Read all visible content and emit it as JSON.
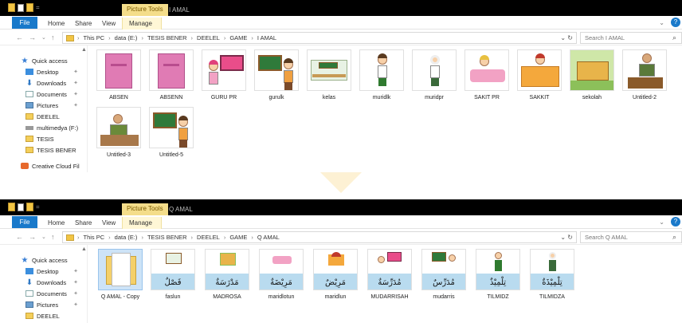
{
  "windows": [
    {
      "picture_tools": "Picture Tools",
      "title": "I AMAL",
      "tabs": [
        "File",
        "Home",
        "Share",
        "View",
        "Manage"
      ],
      "path": [
        "This PC",
        "data (E:)",
        "TESIS BENER",
        "DEELEL",
        "GAME",
        "I AMAL"
      ],
      "search_placeholder": "Search I AMAL",
      "nav_items": [
        {
          "label": "Quick access",
          "icon": "star-icon"
        },
        {
          "label": "Desktop",
          "icon": "desktop-icon",
          "pin": true
        },
        {
          "label": "Downloads",
          "icon": "download-icon",
          "pin": true
        },
        {
          "label": "Documents",
          "icon": "documents-icon",
          "pin": true
        },
        {
          "label": "Pictures",
          "icon": "pictures-icon",
          "pin": true
        },
        {
          "label": "DEELEL",
          "icon": "folder-icon"
        },
        {
          "label": "multimedya (F:)",
          "icon": "drive-icon"
        },
        {
          "label": "TESIS",
          "icon": "folder-icon"
        },
        {
          "label": "TESIS BENER",
          "icon": "folder-icon"
        },
        {
          "label": "Creative Cloud Fil",
          "icon": "creative-cloud-icon"
        }
      ],
      "files": [
        "ABSEN",
        "ABSENN",
        "GURU PR",
        "gurulk",
        "kelas",
        "muridlk",
        "muridpr",
        "SAKIT PR",
        "SAKKIT",
        "sekolah",
        "Untitled-2",
        "Untitled-3",
        "Untitled-5"
      ]
    },
    {
      "picture_tools": "Picture Tools",
      "title": "Q AMAL",
      "tabs": [
        "File",
        "Home",
        "Share",
        "View",
        "Manage"
      ],
      "path": [
        "This PC",
        "data (E:)",
        "TESIS BENER",
        "DEELEL",
        "GAME",
        "Q AMAL"
      ],
      "search_placeholder": "Search Q AMAL",
      "nav_items": [
        {
          "label": "Quick access",
          "icon": "star-icon"
        },
        {
          "label": "Desktop",
          "icon": "desktop-icon",
          "pin": true
        },
        {
          "label": "Downloads",
          "icon": "download-icon",
          "pin": true
        },
        {
          "label": "Documents",
          "icon": "documents-icon",
          "pin": true
        },
        {
          "label": "Pictures",
          "icon": "pictures-icon",
          "pin": true
        },
        {
          "label": "DEELEL",
          "icon": "folder-icon"
        }
      ],
      "files": [
        {
          "name": "Q AMAL - Copy",
          "arabic": ""
        },
        {
          "name": "faslun",
          "arabic": "فَصْلٌ"
        },
        {
          "name": "MADROSA",
          "arabic": "مَدْرَسَةٌ"
        },
        {
          "name": "maridlotun",
          "arabic": "مَرِيْضَةٌ"
        },
        {
          "name": "maridlun",
          "arabic": "مَرِيْضٌ"
        },
        {
          "name": "MUDARRISAH",
          "arabic": "مُدَرِّسَةٌ"
        },
        {
          "name": "mudarris",
          "arabic": "مُدَرِّسٌ"
        },
        {
          "name": "TILMIDZ",
          "arabic": "تِلْمِيْذٌ"
        },
        {
          "name": "TILMIDZA",
          "arabic": "تِلْمِيْذَةٌ"
        }
      ]
    }
  ],
  "colors": {
    "file_tab": "#1979ca",
    "picture_tools": "#f4dd8a",
    "folder": "#f2c544",
    "card_bottom": "#b9dbef",
    "arrow": "#fdf1d4"
  }
}
